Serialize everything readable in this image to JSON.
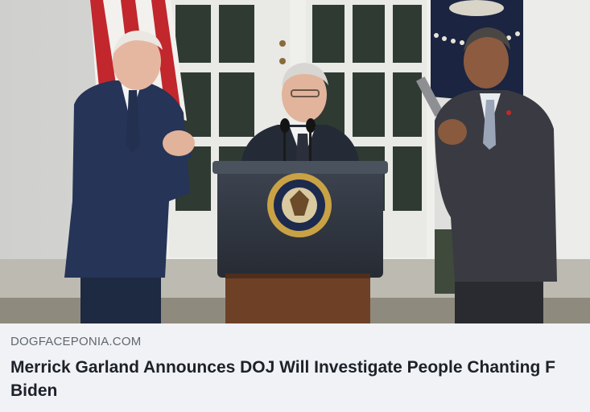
{
  "link_preview": {
    "domain": "DOGFACEPONIA.COM",
    "headline": "Merrick Garland Announces DOJ Will Investigate People Chanting F Biden"
  },
  "image": {
    "icon": "press-photo-image"
  },
  "colors": {
    "caption_background": "#f0f2f5",
    "domain_text": "#606770",
    "headline_text": "#1d2129"
  }
}
